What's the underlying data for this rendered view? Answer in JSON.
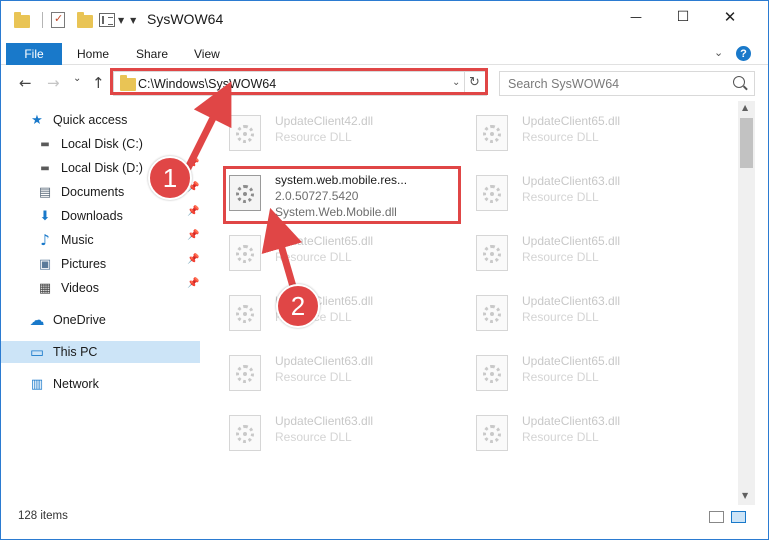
{
  "window": {
    "title": "SysWOW64",
    "minimize_glyph": "—",
    "maximize_glyph": "☐",
    "close_glyph": "✕"
  },
  "ribbon": {
    "file_tab": "File",
    "home_tab": "Home",
    "share_tab": "Share",
    "view_tab": "View",
    "help_glyph": "?",
    "expand_glyph": "⌄"
  },
  "nav": {
    "back_glyph": "←",
    "forward_glyph": "→",
    "recent_glyph": "⌄",
    "up_glyph": "↑",
    "address": "C:\\Windows\\SysWOW64",
    "address_dropdown_glyph": "⌄",
    "refresh_glyph": "↻",
    "search_placeholder": "Search SysWOW64"
  },
  "sidebar": {
    "items": [
      {
        "label": "Quick access",
        "icon": "star-icon",
        "glyph": "★",
        "color": "#1979ca",
        "pinned": false
      },
      {
        "label": "Local Disk (C:)",
        "icon": "drive-icon",
        "glyph": "▬",
        "color": "#5a5a5a",
        "pinned": true
      },
      {
        "label": "Local Disk (D:)",
        "icon": "drive-icon",
        "glyph": "▬",
        "color": "#5a5a5a",
        "pinned": true
      },
      {
        "label": "Documents",
        "icon": "documents-icon",
        "glyph": "▤",
        "color": "#5a6a7a",
        "pinned": true
      },
      {
        "label": "Downloads",
        "icon": "download-arrow-icon",
        "glyph": "⬇",
        "color": "#1979ca",
        "pinned": true
      },
      {
        "label": "Music",
        "icon": "music-note-icon",
        "glyph": "♪",
        "color": "#1979ca",
        "pinned": true
      },
      {
        "label": "Pictures",
        "icon": "pictures-icon",
        "glyph": "▣",
        "color": "#5a7a9a",
        "pinned": true
      },
      {
        "label": "Videos",
        "icon": "film-icon",
        "glyph": "▦",
        "color": "#444444",
        "pinned": true
      },
      {
        "label": "OneDrive",
        "icon": "cloud-icon",
        "glyph": "☁",
        "color": "#1979ca",
        "pinned": false
      },
      {
        "label": "This PC",
        "icon": "monitor-icon",
        "glyph": "▭",
        "color": "#1979ca",
        "pinned": false,
        "selected": true
      },
      {
        "label": "Network",
        "icon": "network-icon",
        "glyph": "▥",
        "color": "#1979ca",
        "pinned": false
      }
    ],
    "pin_glyph": "📌"
  },
  "files": {
    "left_column": [
      {
        "name": "UpdateClient42.dll",
        "type": "Resource DLL"
      },
      {
        "name": "system.web.mobile.res...",
        "version": "2.0.50727.5420",
        "description": "System.Web.Mobile.dll",
        "selected": true
      },
      {
        "name": "UpdateClient65.dll",
        "type": "Resource DLL"
      },
      {
        "name": "UpdateClient65.dll",
        "type": "Resource DLL"
      },
      {
        "name": "UpdateClient63.dll",
        "type": "Resource DLL"
      },
      {
        "name": "UpdateClient63.dll",
        "type": "Resource DLL"
      }
    ],
    "right_column": [
      {
        "name": "UpdateClient65.dll",
        "type": "Resource DLL"
      },
      {
        "name": "UpdateClient63.dll",
        "type": "Resource DLL"
      },
      {
        "name": "UpdateClient65.dll",
        "type": "Resource DLL"
      },
      {
        "name": "UpdateClient63.dll",
        "type": "Resource DLL"
      },
      {
        "name": "UpdateClient65.dll",
        "type": "Resource DLL"
      },
      {
        "name": "UpdateClient63.dll",
        "type": "Resource DLL"
      }
    ]
  },
  "status": {
    "item_count": "128 items"
  },
  "callouts": [
    {
      "number": "1"
    },
    {
      "number": "2"
    }
  ],
  "colors": {
    "accent": "#1979ca",
    "highlight_red": "#e04646",
    "selection": "#cce4f7"
  }
}
